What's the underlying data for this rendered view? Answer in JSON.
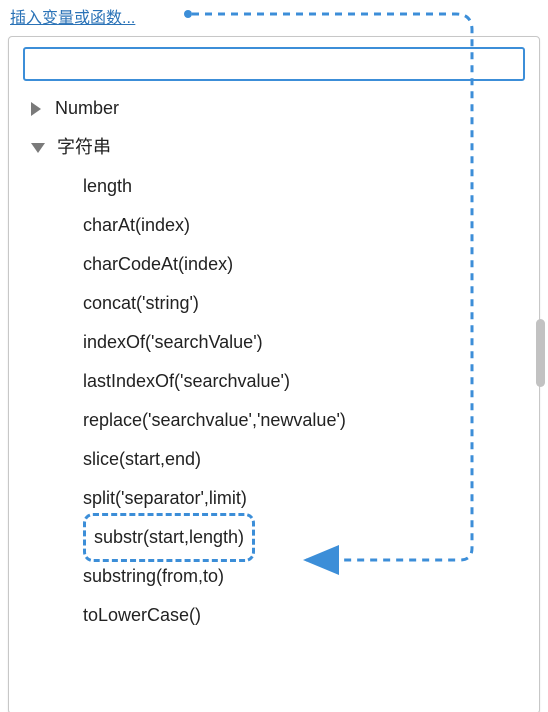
{
  "header": {
    "link_label": "插入变量或函数..."
  },
  "search": {
    "value": "",
    "placeholder": ""
  },
  "tree": {
    "groups": [
      {
        "label": "Number",
        "expanded": false
      },
      {
        "label": "字符串",
        "expanded": true
      }
    ],
    "string_items": [
      "length",
      "charAt(index)",
      "charCodeAt(index)",
      "concat('string')",
      "indexOf('searchValue')",
      "lastIndexOf('searchvalue')",
      "replace('searchvalue','newvalue')",
      "slice(start,end)",
      "split('separator',limit)",
      "substr(start,length)",
      "substring(from,to)",
      "toLowerCase()"
    ],
    "highlighted_index": 9
  },
  "annotation": {
    "color": "#3c8ed8"
  }
}
